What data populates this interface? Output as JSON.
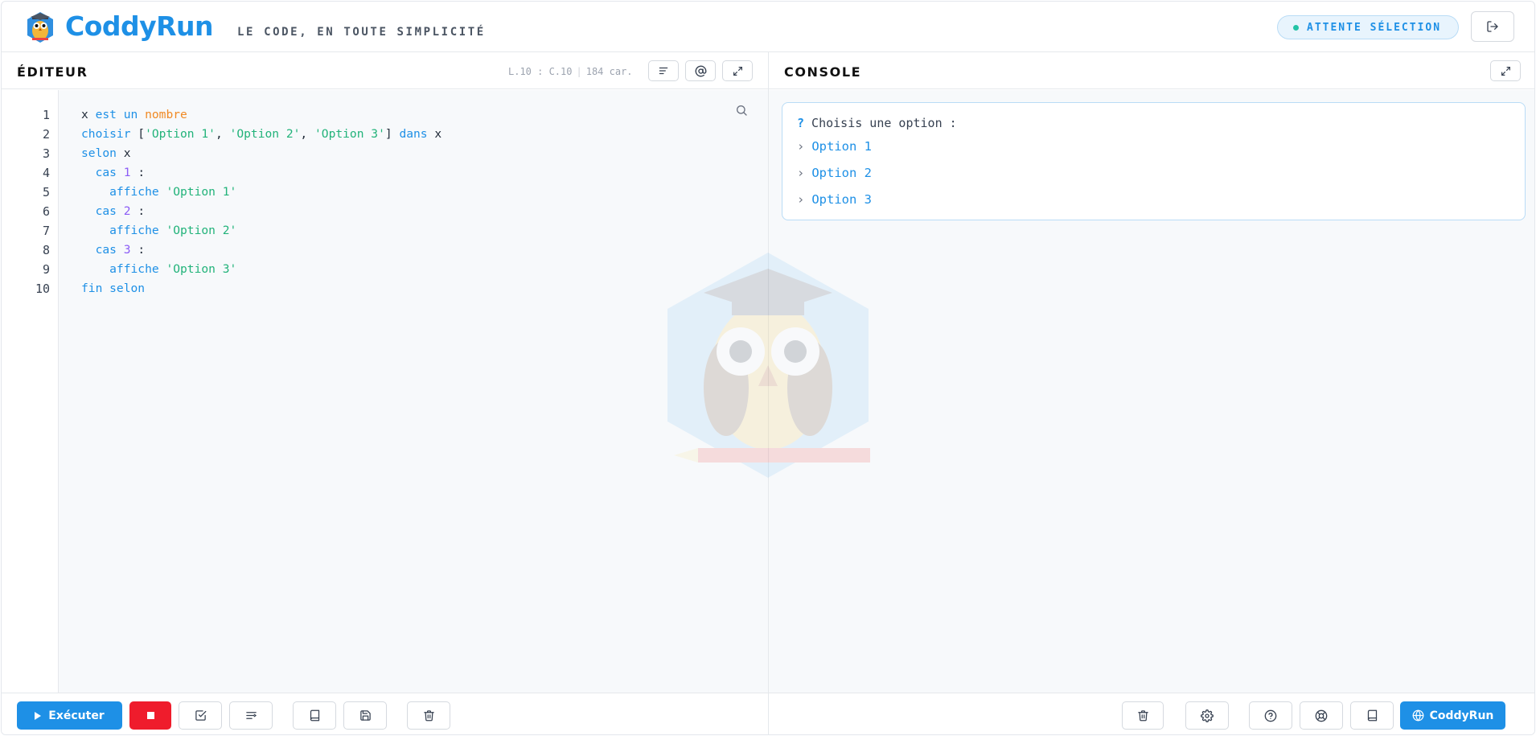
{
  "header": {
    "brand": "CoddyRun",
    "tagline": "LE CODE, EN TOUTE SIMPLICITÉ",
    "status": "ATTENTE SÉLECTION",
    "logout_icon": "logout-icon"
  },
  "editor": {
    "title": "ÉDITEUR",
    "position": "L.10 : C.10",
    "chars": "184 car.",
    "line_numbers": [
      "1",
      "2",
      "3",
      "4",
      "5",
      "6",
      "7",
      "8",
      "9",
      "10"
    ],
    "tools": [
      "format-lines-icon",
      "at-sign-icon",
      "expand-icon"
    ],
    "search_icon": "search-icon"
  },
  "code": {
    "l1": {
      "a": "x ",
      "b": "est un",
      "c": " ",
      "d": "nombre"
    },
    "l2": {
      "a": "choisir",
      "b": " [",
      "c": "'Option 1'",
      "d": ", ",
      "e": "'Option 2'",
      "f": ", ",
      "g": "'Option 3'",
      "h": "] ",
      "i": "dans",
      "j": " x"
    },
    "l3": {
      "a": "selon",
      "b": " x"
    },
    "l4": {
      "a": "  cas",
      "b": " ",
      "c": "1",
      "d": " :"
    },
    "l5": {
      "a": "    affiche",
      "b": " ",
      "c": "'Option 1'"
    },
    "l6": {
      "a": "  cas",
      "b": " ",
      "c": "2",
      "d": " :"
    },
    "l7": {
      "a": "    affiche",
      "b": " ",
      "c": "'Option 2'"
    },
    "l8": {
      "a": "  cas",
      "b": " ",
      "c": "3",
      "d": " :"
    },
    "l9": {
      "a": "    affiche",
      "b": " ",
      "c": "'Option 3'"
    },
    "l10": {
      "a": "fin selon"
    }
  },
  "console": {
    "title": "CONSOLE",
    "prompt_mark": "?",
    "prompt": " Choisis une option :",
    "chevron": "›",
    "options": [
      "Option 1",
      "Option 2",
      "Option 3"
    ]
  },
  "footer": {
    "run_label": "Exécuter",
    "coddy_label": "CoddyRun"
  },
  "colors": {
    "accent": "#1e90e6",
    "stop": "#ef1c2c",
    "keyword": "#1e90e6",
    "type": "#f08a24",
    "string": "#22b37a",
    "number": "#8b5cf6"
  }
}
